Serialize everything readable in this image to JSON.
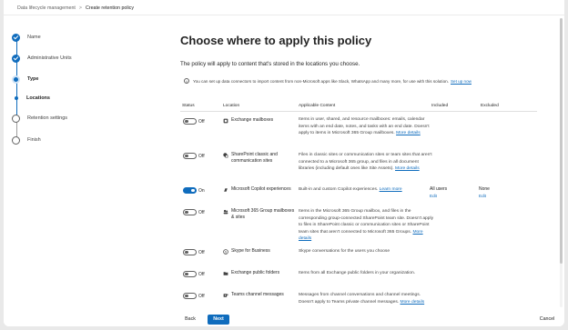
{
  "breadcrumb": {
    "parent": "Data lifecycle management",
    "separator": ">",
    "current": "Create retention policy"
  },
  "steps": [
    {
      "label": "Name",
      "state": "done"
    },
    {
      "label": "Administrative Units",
      "state": "done"
    },
    {
      "label": "Type",
      "state": "current"
    },
    {
      "label": "Locations",
      "state": "substep"
    },
    {
      "label": "Retention settings",
      "state": "todo"
    },
    {
      "label": "Finish",
      "state": "todo"
    }
  ],
  "page": {
    "title": "Choose where to apply this policy",
    "subtitle": "The policy will apply to content that's stored in the locations you choose.",
    "info_text": "You can set up data connectors to import content from non-Microsoft apps like Slack, WhatsApp and many more, for use with this solution.",
    "info_link": "Set up now"
  },
  "table": {
    "headers": {
      "status": "Status",
      "location": "Location",
      "content": "Applicable Content",
      "included": "Included",
      "excluded": "Excluded"
    },
    "rows": [
      {
        "status": "Off",
        "on": false,
        "icon": "exchange-icon",
        "location": "Exchange mailboxes",
        "content": "Items in user, shared, and resource mailboxes: emails, calendar items with an end date, notes, and tasks with an end date. Doesn't apply to items in Microsoft 365 Group mailboxes.",
        "link": "More details"
      },
      {
        "status": "Off",
        "on": false,
        "icon": "sharepoint-icon",
        "location": "SharePoint classic and communication sites",
        "content": "Files in classic sites or communication sites or team sites that aren't connected to a Microsoft 365 group, and files in all document libraries (including default ones like Site Assets).",
        "link": "More details"
      },
      {
        "status": "On",
        "on": true,
        "icon": "copilot-icon",
        "location": "Microsoft Copilot experiences",
        "content": "Built-in and custom Copilot experiences.",
        "link": "Learn more",
        "included": "All users",
        "included_edit": "Edit",
        "excluded": "None",
        "excluded_edit": "Edit"
      },
      {
        "status": "Off",
        "on": false,
        "icon": "group-icon",
        "location": "Microsoft 365 Group mailboxes & sites",
        "content": "Items in the Microsoft 365 Group mailbox, and files in the corresponding group-connected SharePoint team site. Doesn't apply to files in SharePoint classic or communication sites or SharePoint team sites that aren't connected to Microsoft 365 Groups.",
        "link": "More details"
      },
      {
        "status": "Off",
        "on": false,
        "icon": "skype-icon",
        "location": "Skype for Business",
        "content": "Skype conversations for the users you choose",
        "link": ""
      },
      {
        "status": "Off",
        "on": false,
        "icon": "public-folder-icon",
        "location": "Exchange public folders",
        "content": "Items from all Exchange public folders in your organization.",
        "link": ""
      },
      {
        "status": "Off",
        "on": false,
        "icon": "teams-icon",
        "location": "Teams channel messages",
        "content": "Messages from channel conversations and channel meetings. Doesn't apply to Teams private channel messages.",
        "link": "More details"
      }
    ]
  },
  "buttons": {
    "back": "Back",
    "next": "Next",
    "cancel": "Cancel"
  },
  "colors": {
    "accent": "#0f6cbd",
    "text": "#242424"
  }
}
